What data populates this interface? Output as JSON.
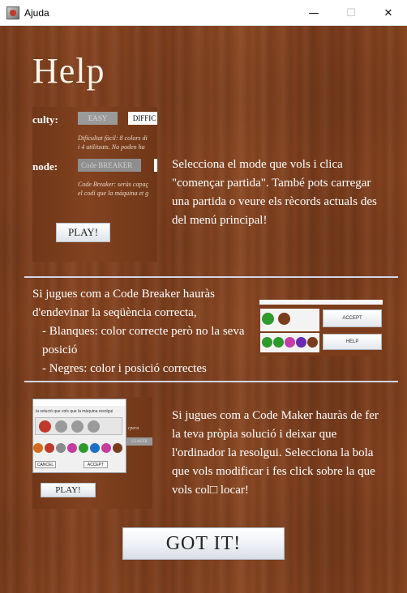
{
  "window": {
    "title": "Ajuda",
    "controls": {
      "minimize": "—",
      "maximize": "☐",
      "close": "✕"
    }
  },
  "help": {
    "title": "Help",
    "sections": [
      {
        "text": "Selecciona el mode que vols i clica \"començar partida\". També pots carregar una partida o veure els rècords actuals des del menú principal!"
      },
      {
        "lines": [
          "Si jugues com a Code Breaker hauràs d'endevinar la seqüència correcta,",
          "- Blanques: color correcte però no la seva posició",
          "- Negres: color i posició correctes"
        ]
      },
      {
        "text": "Si jugues com a Code Maker hauràs de fer la teva pròpia solució i deixar que l'ordinador la resolgui. Selecciona la bola que vols modificar i fes click sobre la que vols col□ locar!"
      }
    ],
    "got_it_label": "GOT IT!"
  },
  "previews": {
    "difficulty": {
      "difficulty_label": "culty:",
      "easy": "EASY",
      "difficult": "DIFFIC",
      "easy_desc_1": "Dificultat fàcil: 8 colors di",
      "easy_desc_2": "i 4 utilitzats. No poden ha",
      "mode_label": "node:",
      "mode_value": "Code BREAKER",
      "mode_desc_1": "Code Breaker: seràs capaç",
      "mode_desc_2": "el codi que la màquina et g",
      "play": "PLAY!"
    },
    "board": {
      "accept": "ACCEPT",
      "help": "HELP",
      "row1_colors": [
        "#2e9a2e",
        "#7a3d1c"
      ],
      "row2_colors": [
        "#2e9a2e",
        "#2e9a2e",
        "#c63ca8",
        "#6a2bb0",
        "#7a3d1c"
      ]
    },
    "maker": {
      "dialog_text": "la solució que vols que la màquina resolgui",
      "cancel": "CANCEL",
      "accept": "ACCEPT",
      "side_text": "rpera",
      "side_btn": "LEAKER",
      "play": "PLAY!",
      "selection_colors": [
        "#c0392b",
        "#9a9a9a",
        "#9a9a9a",
        "#9a9a9a"
      ],
      "palette_colors": [
        "#d46a1e",
        "#c0392b",
        "#8a8a8a",
        "#c43ca0",
        "#2e9a2e",
        "#1f6fc8",
        "#c43ca0",
        "#7a3d1c"
      ]
    }
  }
}
